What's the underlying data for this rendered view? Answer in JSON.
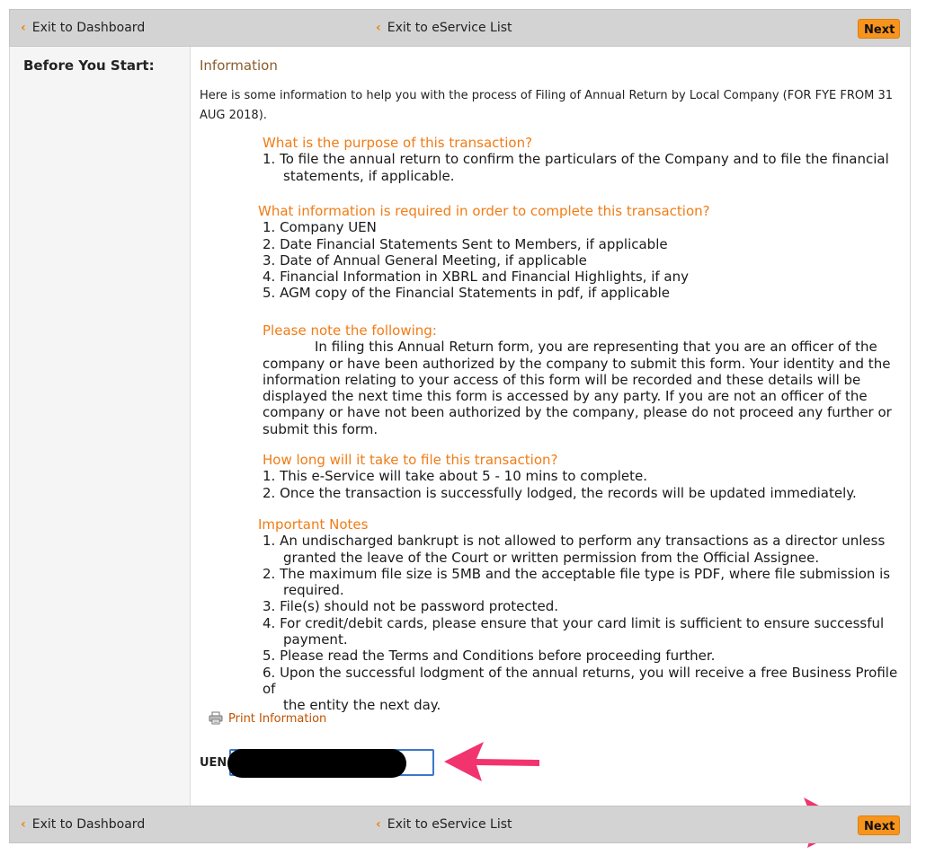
{
  "nav": {
    "exit_dashboard": "Exit to Dashboard",
    "exit_eservice": "Exit to eService List",
    "next": "Next",
    "chevron": "‹"
  },
  "sidebar": {
    "title": "Before You Start:"
  },
  "main": {
    "heading": "Information",
    "intro": "Here is some information to help you with the process of Filing of Annual Return by Local Company (FOR FYE FROM 31 AUG 2018).",
    "purpose": {
      "title": "What is the purpose of this transaction?",
      "items": [
        "1.   To file the annual return to confirm the particulars of the Company and to file the financial",
        "statements, if applicable."
      ]
    },
    "required": {
      "title": "What information is required in order to complete this transaction?",
      "items": [
        "1.   Company UEN",
        "2.   Date Financial Statements Sent to Members, if applicable",
        "3.   Date of Annual General Meeting, if applicable",
        "4.   Financial Information in XBRL and Financial Highlights, if any",
        "5.   AGM copy of the Financial Statements in pdf, if applicable"
      ]
    },
    "note": {
      "title": "Please note the following:",
      "lines": [
        "In filing this Annual Return form, you are representing that you are an officer of the",
        "company or have been authorized by the company to submit this form. Your identity and the",
        "information relating to your access of this form will be recorded and these details will be",
        "displayed the next time this form is accessed by any party. If you are not an officer of the",
        "company or have not been authorized by the company, please do not proceed any further or",
        "submit this form."
      ]
    },
    "duration": {
      "title": "How long will it take to file this transaction?",
      "items": [
        "1.   This e-Service will take about 5 - 10 mins to complete.",
        "2.   Once the transaction is successfully lodged, the records will be updated immediately."
      ]
    },
    "important": {
      "title": "Important Notes",
      "lines": [
        "1.  An undischarged bankrupt is not allowed to perform any transactions as a director unless",
        "granted the leave of the Court or written permission from the Official Assignee.",
        "2.  The maximum file size is 5MB and the acceptable file type is PDF, where file submission is",
        "required.",
        "3.  File(s) should not be password protected.",
        "4. For credit/debit cards, please ensure that your card limit is sufficient to ensure successful",
        "payment.",
        "5.  Please read the Terms and Conditions before proceeding further.",
        "6.  Upon the successful lodgment of the annual returns, you will receive a free Business Profile of",
        "the entity the next day."
      ]
    },
    "print_label": "Print Information",
    "uen_label": "UEN",
    "uen_value": ""
  },
  "colors": {
    "accent_orange": "#f07c16",
    "next_button": "#f7941d",
    "heading_brown": "#8a5c2c",
    "annotation_arrow": "#f2346e",
    "input_border": "#3c78c8"
  },
  "icons": [
    "chevron-left-icon",
    "printer-icon",
    "annotation-arrow-icon"
  ]
}
